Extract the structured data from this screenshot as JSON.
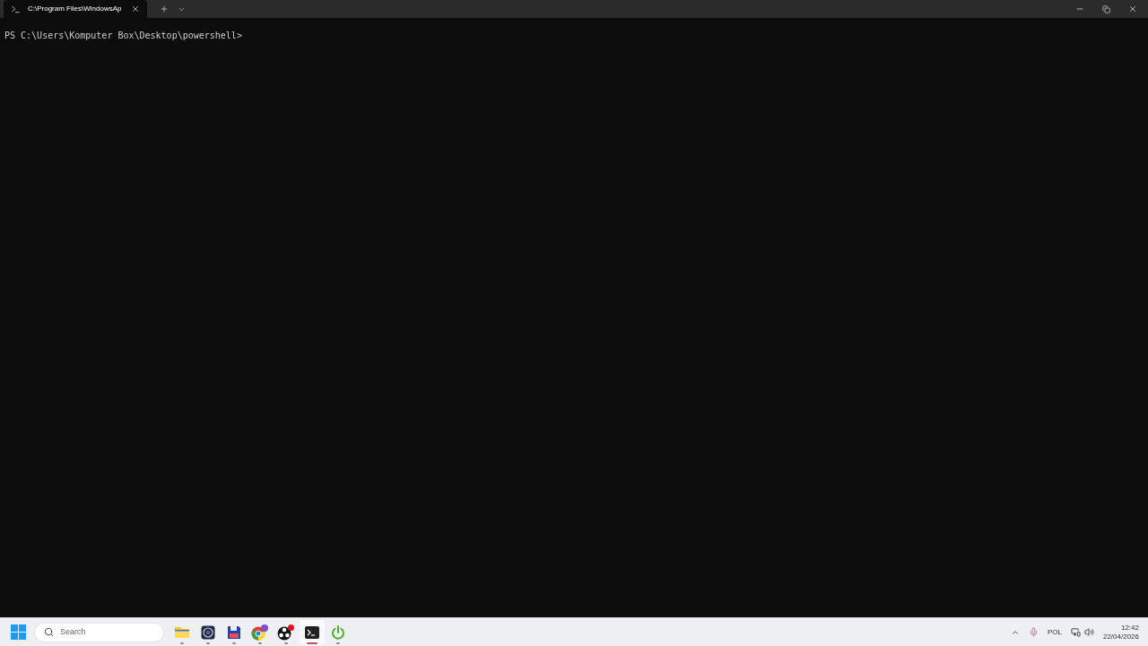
{
  "window": {
    "tab": {
      "title": "C:\\Program Files\\WindowsAp",
      "selected": true
    }
  },
  "terminal": {
    "prompt": "PS C:\\Users\\Komputer Box\\Desktop\\powershell>"
  },
  "taskbar": {
    "search": {
      "placeholder": "Search"
    },
    "apps": [
      {
        "kind": "folder",
        "selected": false
      },
      {
        "kind": "camera",
        "selected": false
      },
      {
        "kind": "floppy",
        "selected": false
      },
      {
        "kind": "browser",
        "selected": false
      },
      {
        "kind": "recorder",
        "selected": false
      },
      {
        "kind": "terminal",
        "selected": true
      },
      {
        "kind": "power",
        "selected": false
      }
    ],
    "tray": {
      "language": "POL",
      "time": "12:42",
      "date": "22/04/2026"
    }
  }
}
